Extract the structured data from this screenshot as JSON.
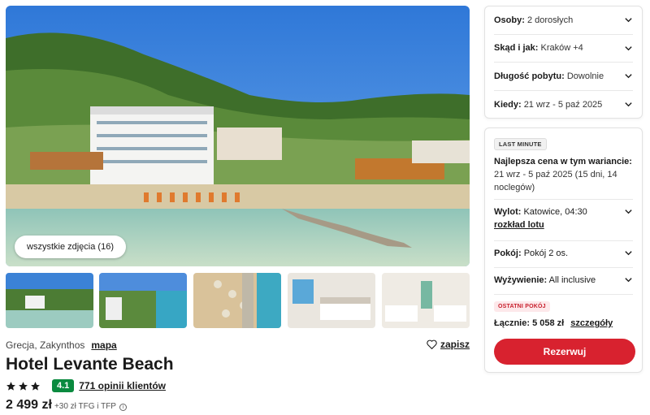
{
  "gallery": {
    "all_photos_label": "wszystkie zdjęcia (16)",
    "thumbnails": [
      "beach-hotel-view",
      "coast-aerial-view",
      "beach-umbrellas-aerial",
      "hotel-room-balcony",
      "hotel-room-interior"
    ]
  },
  "hotel": {
    "country_region": "Grecja, Zakynthos",
    "map_label": "mapa",
    "save_label": "zapisz",
    "name": "Hotel Levante Beach",
    "stars": 3,
    "score": "4.1",
    "reviews_label": "771 opinii klientów",
    "price": "2 499 zł",
    "price_extra": "+30 zł TFG i TFP"
  },
  "filters": [
    {
      "label": "Osoby:",
      "value": "2 dorosłych"
    },
    {
      "label": "Skąd i jak:",
      "value": "Kraków +4"
    },
    {
      "label": "Długość pobytu:",
      "value": "Dowolnie"
    },
    {
      "label": "Kiedy:",
      "value": "21 wrz - 5 paź 2025"
    }
  ],
  "offer": {
    "badge": "LAST MINUTE",
    "best_price_label": "Najlepsza cena w tym wariancie:",
    "best_price_dates": "21 wrz - 5 paź 2025 (15 dni, 14 noclegów)",
    "departure_label": "Wylot:",
    "departure_value": "Katowice, 04:30",
    "flight_details": "rozkład lotu",
    "room_label": "Pokój:",
    "room_value": "Pokój 2 os.",
    "board_label": "Wyżywienie:",
    "board_value": "All inclusive",
    "last_room_badge": "OSTATNI POKÓJ",
    "total_label": "Łącznie:",
    "total_value": "5 058 zł",
    "details_link": "szczegóły",
    "reserve_label": "Rezerwuj"
  },
  "colors": {
    "accent_red": "#d8222f",
    "score_green": "#0a8a3f"
  }
}
